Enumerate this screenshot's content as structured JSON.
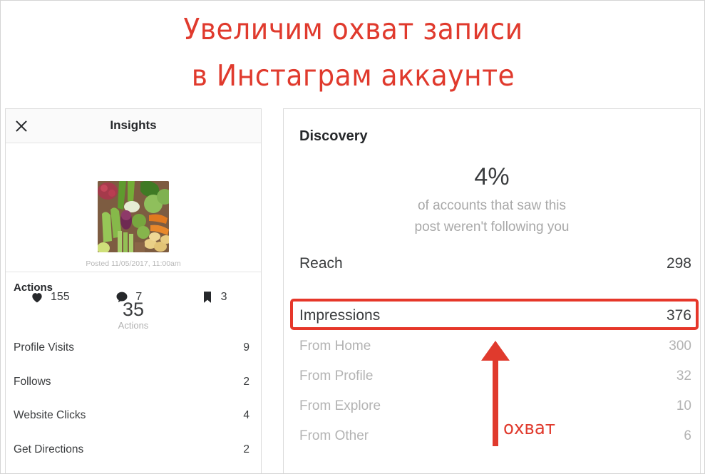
{
  "banner": {
    "line1": "Увеличим охват записи",
    "line2": "в Инстаграм аккаунте",
    "color": "#e03a2d"
  },
  "left_panel": {
    "header": {
      "title": "Insights",
      "close_icon": "close-icon"
    },
    "post": {
      "posted_at": "Posted 11/05/2017, 11:00am",
      "thumbnail_alt": "vegetables-photo"
    },
    "stats": [
      {
        "icon": "heart-icon",
        "value": "155"
      },
      {
        "icon": "comment-icon",
        "value": "7"
      },
      {
        "icon": "bookmark-icon",
        "value": "3"
      }
    ],
    "actions": {
      "heading": "Actions",
      "total": "35",
      "total_label": "Actions",
      "rows": [
        {
          "label": "Profile Visits",
          "value": "9"
        },
        {
          "label": "Follows",
          "value": "2"
        },
        {
          "label": "Website Clicks",
          "value": "4"
        },
        {
          "label": "Get Directions",
          "value": "2"
        }
      ]
    }
  },
  "right_panel": {
    "heading": "Discovery",
    "percent": "4%",
    "percent_note_line1": "of accounts that saw this",
    "percent_note_line2": "post weren't following you",
    "rows": [
      {
        "label": "Reach",
        "value": "298"
      },
      {
        "label": "Impressions",
        "value": "376"
      },
      {
        "label": "From Home",
        "value": "300"
      },
      {
        "label": "From Profile",
        "value": "32"
      },
      {
        "label": "From Explore",
        "value": "10"
      },
      {
        "label": "From Other",
        "value": "6"
      }
    ],
    "highlight": {
      "target": "Impressions",
      "color": "#e6372a"
    }
  },
  "annotation": {
    "label": "охват",
    "color": "#e03a2d",
    "arrow_direction": "up",
    "points_at": "Impressions"
  }
}
